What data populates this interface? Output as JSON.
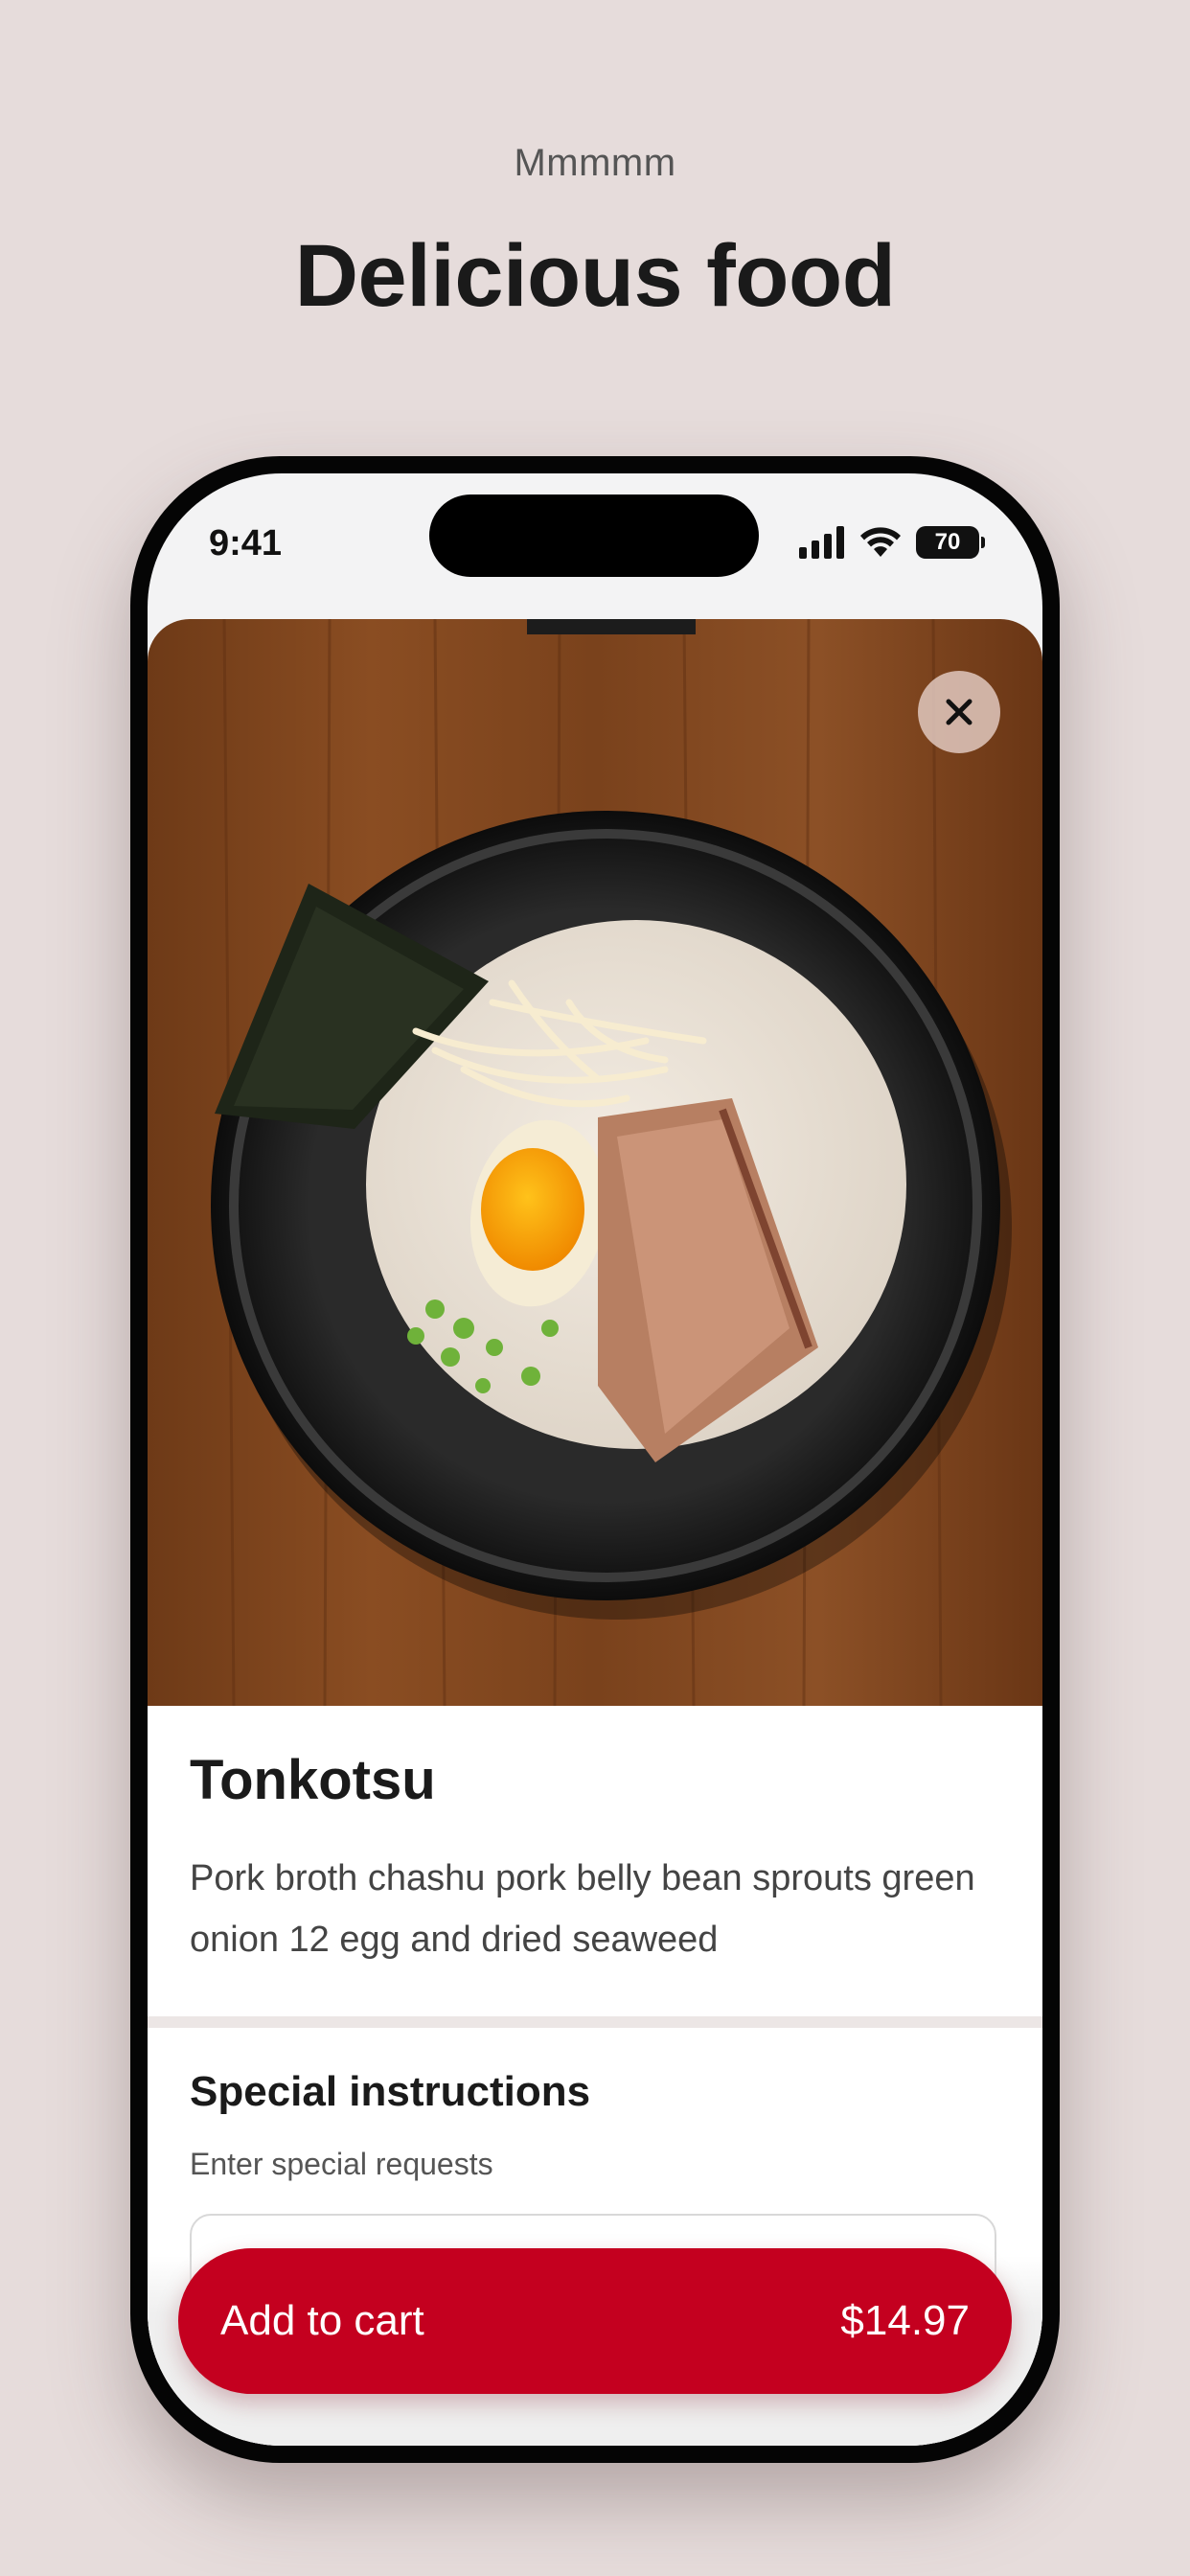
{
  "header": {
    "eyebrow": "Mmmmm",
    "title": "Delicious food"
  },
  "status_bar": {
    "time": "9:41",
    "battery": "70",
    "icons": [
      "signal-icon",
      "wifi-icon",
      "battery-icon"
    ]
  },
  "item": {
    "image": "ramen-bowl-image",
    "name": "Tonkotsu",
    "description": "Pork broth chashu pork belly bean sprouts green onion 12 egg and dried seaweed",
    "close_icon": "close-icon"
  },
  "instructions": {
    "title": "Special instructions",
    "hint": "Enter special requests",
    "value": "",
    "placeholder": ""
  },
  "cart": {
    "label": "Add to cart",
    "price": "$14.97"
  },
  "colors": {
    "background": "#e6dcdb",
    "accent": "#c4001f",
    "text": "#1a1a1a"
  }
}
